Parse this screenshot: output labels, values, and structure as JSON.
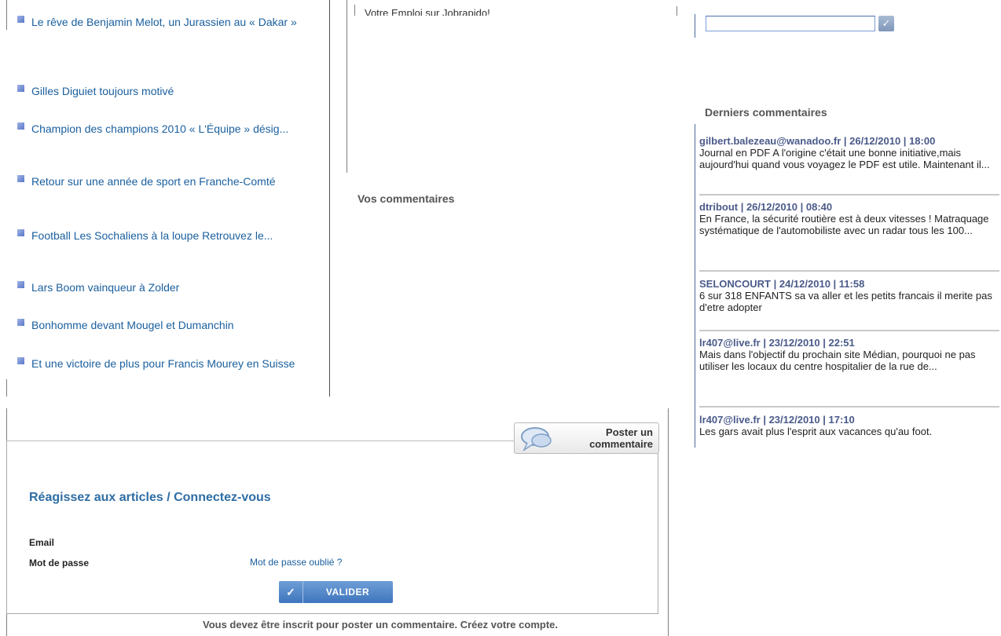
{
  "articles": [
    {
      "title": "Le rêve de Benjamin Melot, un Jurassien au « Dakar »"
    },
    {
      "title": "Gilles Diguiet toujours motivé"
    },
    {
      "title": "Champion des champions 2010 « L'Équipe » désig..."
    },
    {
      "title": "Retour sur une année de sport en Franche-Comté"
    },
    {
      "title": "Football  Les Sochaliens à la loupe Retrouvez le..."
    },
    {
      "title": "Lars Boom vainqueur à Zolder"
    },
    {
      "title": "Bonhomme devant Mougel et Dumanchin"
    },
    {
      "title": "Et une victoire de plus pour Francis Mourey en Suisse"
    }
  ],
  "middle": {
    "top_text": "Votre Emploi sur Jobrapido!",
    "vos_commentaires": "Vos commentaires"
  },
  "search": {
    "value": "",
    "button_icon": "check-icon"
  },
  "derniers": {
    "heading": "Derniers commentaires",
    "items": [
      {
        "meta": "gilbert.balezeau@wanadoo.fr | 26/12/2010 | 18:00",
        "text": "Journal en PDF A l'origine c'était une bonne initiative,mais aujourd'hui quand vous voyagez le PDF est utile. Maintenant il..."
      },
      {
        "meta": "dtribout | 26/12/2010 | 08:40",
        "text": "En France, la sécurité routière est à deux vitesses ! Matraquage systématique de l'automobiliste avec un radar tous les 100..."
      },
      {
        "meta": "SELONCOURT | 24/12/2010 | 11:58",
        "text": "6 sur 318 ENFANTS sa va aller et les petits francais il merite pas d'etre adopter"
      },
      {
        "meta": "lr407@live.fr | 23/12/2010 | 22:51",
        "text": "Mais dans l'objectif du prochain site Médian, pourquoi ne pas utiliser les locaux du centre hospitalier de la rue de..."
      },
      {
        "meta": "lr407@live.fr | 23/12/2010 | 17:10",
        "text": "Les gars avait plus l'esprit aux vacances qu'au foot."
      }
    ]
  },
  "login": {
    "post_button": "Poster un commentaire",
    "title": "Réagissez aux articles / Connectez-vous",
    "email_label": "Email",
    "password_label": "Mot de passe",
    "forgot_link": "Mot de passe oublié ?",
    "submit_label": "VALIDER",
    "notice": "Vous devez être inscrit pour poster un commentaire. Créez votre compte."
  },
  "colors": {
    "link": "#1a5f9e",
    "title_blue": "#2e6da4",
    "button_blue": "#3d75bd",
    "comment_meta": "#4a5a8a"
  }
}
